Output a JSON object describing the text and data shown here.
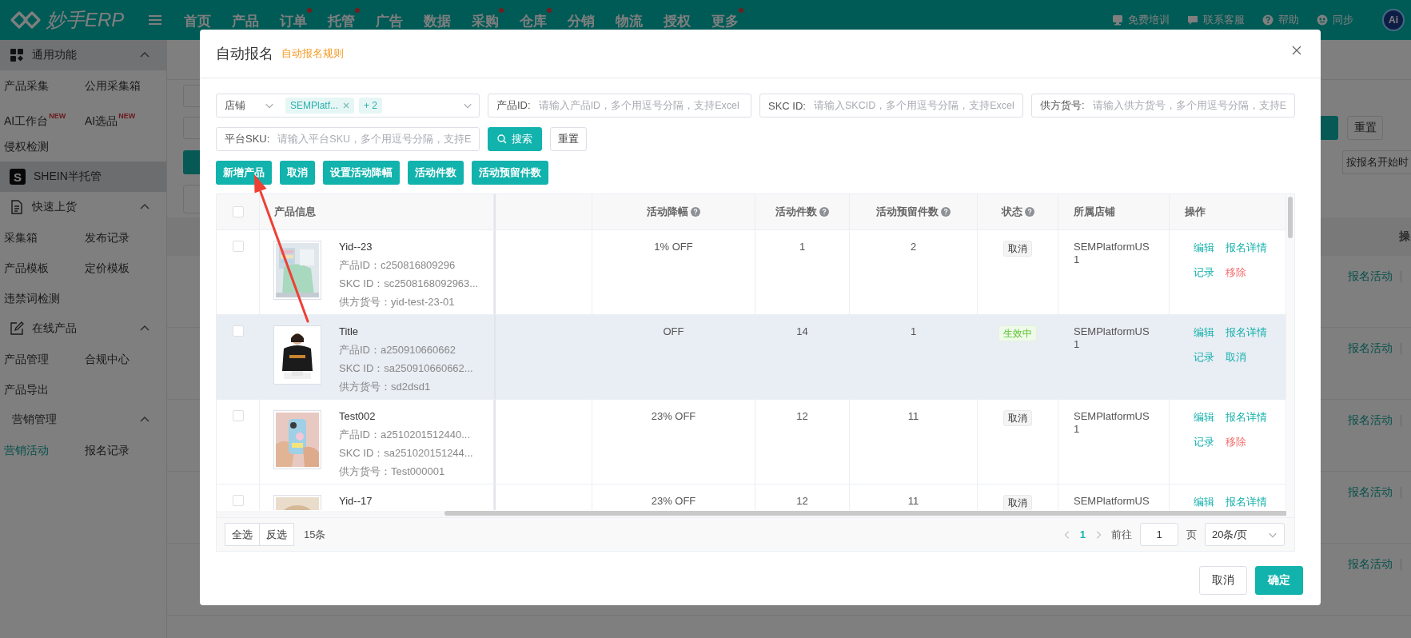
{
  "top_bar": {
    "logo": "妙手ERP",
    "nav": [
      {
        "label": "首页",
        "dot": false
      },
      {
        "label": "产品",
        "dot": false
      },
      {
        "label": "订单",
        "dot": true
      },
      {
        "label": "托管",
        "dot": true
      },
      {
        "label": "广告",
        "dot": false
      },
      {
        "label": "数据",
        "dot": false
      },
      {
        "label": "采购",
        "dot": true
      },
      {
        "label": "仓库",
        "dot": true
      },
      {
        "label": "分销",
        "dot": false
      },
      {
        "label": "物流",
        "dot": false
      },
      {
        "label": "授权",
        "dot": false
      },
      {
        "label": "更多",
        "dot": true
      }
    ],
    "links": [
      {
        "kind": "training",
        "label": "免费培训"
      },
      {
        "kind": "chat",
        "label": "联系客服"
      },
      {
        "kind": "help",
        "label": "帮助"
      },
      {
        "kind": "sync",
        "label": "同步"
      }
    ],
    "avatar": "Ai"
  },
  "sidebar": {
    "sections": [
      {
        "kind": "apps",
        "title": "通用功能",
        "expanded": true,
        "highlighted": true,
        "items": [
          {
            "label": "产品采集",
            "selected": false
          },
          {
            "label": "公用采集箱",
            "selected": false
          },
          {
            "label": "AI工作台",
            "badge": "NEW",
            "selected": false
          },
          {
            "label": "AI选品",
            "badge": "NEW",
            "selected": false
          },
          {
            "label": "侵权检测",
            "selected": false
          }
        ]
      },
      {
        "kind": "brand",
        "title": "SHEIN半托管",
        "logo": "S",
        "highlighted": true
      },
      {
        "kind": "document",
        "title": "快速上货",
        "expanded": true,
        "highlighted": false,
        "items": [
          {
            "label": "采集箱",
            "selected": false
          },
          {
            "label": "发布记录",
            "selected": false
          },
          {
            "label": "产品模板",
            "selected": false
          },
          {
            "label": "定价模板",
            "selected": false
          },
          {
            "label": "违禁词检测",
            "selected": false
          }
        ]
      },
      {
        "kind": "edit",
        "title": "在线产品",
        "expanded": true,
        "highlighted": false,
        "items": [
          {
            "label": "产品管理",
            "selected": false
          },
          {
            "label": "合规中心",
            "selected": false
          },
          {
            "label": "产品导出",
            "selected": false
          }
        ]
      },
      {
        "kind": "plain",
        "title": "营销管理",
        "expanded": true,
        "highlighted": false,
        "items": [
          {
            "label": "营销活动",
            "selected": true
          },
          {
            "label": "报名记录",
            "selected": false
          }
        ]
      }
    ]
  },
  "page": {
    "reset_button": "重置",
    "sort_select": "按报名开始时",
    "column_header": "操",
    "row_actions": [
      "报名活动",
      "报名活动",
      "报名活动",
      "报名活动",
      "报名活动"
    ]
  },
  "dialog": {
    "title": "自动报名",
    "rule_link": "自动报名规则",
    "store_filter": {
      "label": "店铺",
      "tags": [
        "SEMPlatf..."
      ],
      "more": "+ 2"
    },
    "text_filters": [
      {
        "label": "产品ID:",
        "placeholder": "请输入产品ID，多个用逗号分隔，支持Excel"
      },
      {
        "label": "SKC ID:",
        "placeholder": "请输入SKCID，多个用逗号分隔，支持Excel"
      },
      {
        "label": "供方货号:",
        "placeholder": "请输入供方货号，多个用逗号分隔，支持E"
      },
      {
        "label": "平台SKU:",
        "placeholder": "请输入平台SKU，多个用逗号分隔，支持E"
      }
    ],
    "search_button": "搜索",
    "reset_button": "重置",
    "actions": [
      "新增产品",
      "取消",
      "设置活动降幅",
      "活动件数",
      "活动预留件数"
    ],
    "table": {
      "all_checked": false,
      "columns": [
        {
          "label": "产品信息",
          "help": false
        },
        {
          "label": "活动降幅",
          "help": true
        },
        {
          "label": "活动件数",
          "help": true
        },
        {
          "label": "活动预留件数",
          "help": true
        },
        {
          "label": "状态",
          "help": true
        },
        {
          "label": "所属店铺",
          "help": false
        },
        {
          "label": "操作",
          "help": false
        }
      ],
      "rows": [
        {
          "checked": false,
          "hovered": false,
          "image": {
            "kind": "picture"
          },
          "name": "Yid--23",
          "details": [
            "产品ID：c250816809296",
            "SKC ID：sc2508168092963...",
            "供方货号：yid-test-23-01"
          ],
          "discount": "1% OFF",
          "count": "1",
          "reserved": "2",
          "status": "取消",
          "status_active": false,
          "store": "SEMPlatformUS1",
          "actions": [
            {
              "label": "编辑",
              "kind": "primary"
            },
            {
              "label": "报名详情",
              "kind": "primary"
            },
            {
              "label": "记录",
              "kind": "primary"
            },
            {
              "label": "移除",
              "kind": "danger"
            }
          ]
        },
        {
          "checked": false,
          "hovered": true,
          "image": {
            "kind": "picture"
          },
          "name": "Title",
          "details": [
            "产品ID：a250910660662",
            "SKC ID：sa250910660662...",
            "供方货号：sd2dsd1"
          ],
          "discount": "OFF",
          "count": "14",
          "reserved": "1",
          "status": "生效中",
          "status_active": true,
          "store": "SEMPlatformUS1",
          "actions": [
            {
              "label": "编辑",
              "kind": "primary"
            },
            {
              "label": "报名详情",
              "kind": "primary"
            },
            {
              "label": "记录",
              "kind": "primary"
            },
            {
              "label": "取消",
              "kind": "primary"
            }
          ]
        },
        {
          "checked": false,
          "hovered": false,
          "image": {
            "kind": "picture"
          },
          "name": "Test002",
          "details": [
            "产品ID：a2510201512440...",
            "SKC ID：sa251020151244...",
            "供方货号：Test000001"
          ],
          "discount": "23% OFF",
          "count": "12",
          "reserved": "11",
          "status": "取消",
          "status_active": false,
          "store": "SEMPlatformUS1",
          "actions": [
            {
              "label": "编辑",
              "kind": "primary"
            },
            {
              "label": "报名详情",
              "kind": "primary"
            },
            {
              "label": "记录",
              "kind": "primary"
            },
            {
              "label": "移除",
              "kind": "danger"
            }
          ]
        },
        {
          "checked": false,
          "hovered": false,
          "image": {
            "kind": "picture"
          },
          "name": "Yid--17",
          "discount": "23% OFF",
          "count": "12",
          "reserved": "11",
          "status": "取消",
          "status_active": false,
          "store": "SEMPlatformUS",
          "actions": [
            {
              "label": "编辑",
              "kind": "primary"
            },
            {
              "label": "报名详情",
              "kind": "primary"
            }
          ]
        }
      ]
    },
    "footer": {
      "select_all": "全选",
      "invert": "反选",
      "total": "15条",
      "current_page": "1",
      "goto_label": "前往",
      "goto_value": "1",
      "page_unit": "页",
      "page_size": "20条/页"
    },
    "buttons": [
      {
        "kind": "cancel",
        "label": "取消"
      },
      {
        "kind": "confirm",
        "label": "确定"
      }
    ]
  }
}
